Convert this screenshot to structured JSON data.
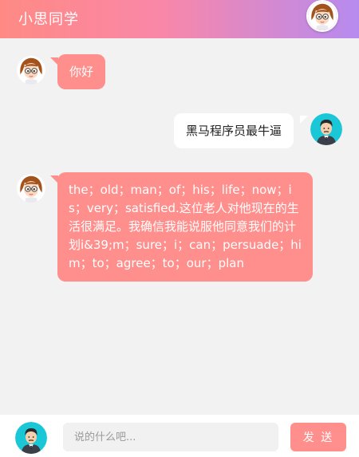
{
  "header": {
    "title": "小思同学"
  },
  "messages": [
    {
      "side": "left",
      "text": "你好"
    },
    {
      "side": "right",
      "text": "黑马程序员最牛逼"
    },
    {
      "side": "left",
      "text": "the；old；man；of；his；life；now；is；very；satisfied.这位老人对他现在的生活很满足。我确信我能说服他同意我们的计划i&39;m；sure；i；can；persuade；him；to；agree；to；our；plan"
    }
  ],
  "footer": {
    "input_placeholder": "说的什么吧...",
    "send_label": "发 送"
  },
  "colors": {
    "header_gradient": [
      "#ff8a84",
      "#f987a8",
      "#b68bf0"
    ],
    "bot_bubble": "#ff8f8c",
    "user_bubble": "#ffffff",
    "send_button": "#ff8f8c",
    "background": "#f2f2f2"
  },
  "icons": {
    "bot_avatar": "girl-avatar-icon",
    "user_avatar": "boy-avatar-icon"
  }
}
